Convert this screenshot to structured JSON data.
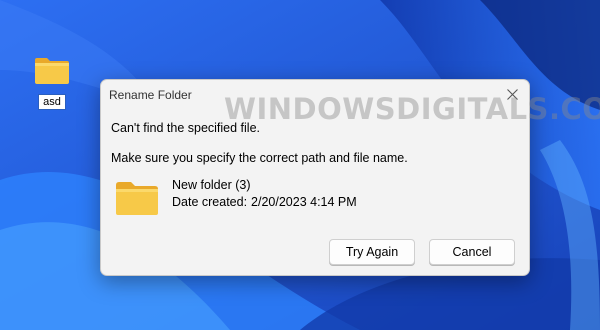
{
  "desktop": {
    "icon_label": "asd",
    "colors": {
      "background": "#1f5fe0",
      "folder": "#f5c542"
    }
  },
  "dialog": {
    "title": "Rename Folder",
    "error_message": "Can't find the specified file.",
    "hint_message": "Make sure you specify the correct path and file name.",
    "file": {
      "name": "New folder (3)",
      "date_label": "Date created:",
      "date_value": "2/20/2023 4:14 PM",
      "icon": "folder-icon"
    },
    "buttons": {
      "try_again": "Try Again",
      "cancel": "Cancel"
    },
    "close_icon": "close-icon"
  },
  "watermark": {
    "text": "WindowsDigitals.com"
  }
}
